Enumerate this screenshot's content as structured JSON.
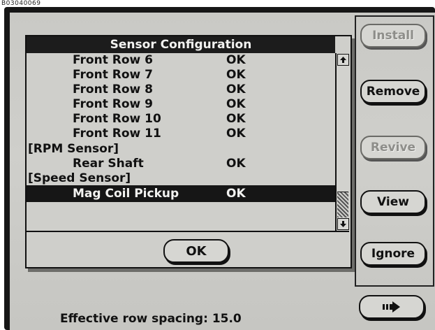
{
  "page_id": "B03040069",
  "dialog": {
    "title": "Sensor Configuration",
    "rows": [
      {
        "label": "Front Row 6",
        "status": "OK",
        "indent": true,
        "selected": false
      },
      {
        "label": "Front Row 7",
        "status": "OK",
        "indent": true,
        "selected": false
      },
      {
        "label": "Front Row 8",
        "status": "OK",
        "indent": true,
        "selected": false
      },
      {
        "label": "Front Row 9",
        "status": "OK",
        "indent": true,
        "selected": false
      },
      {
        "label": "Front Row 10",
        "status": "OK",
        "indent": true,
        "selected": false
      },
      {
        "label": "Front Row 11",
        "status": "OK",
        "indent": true,
        "selected": false
      },
      {
        "label": "[RPM Sensor]",
        "status": "",
        "indent": false,
        "selected": false
      },
      {
        "label": "Rear Shaft",
        "status": "OK",
        "indent": true,
        "selected": false
      },
      {
        "label": "[Speed Sensor]",
        "status": "",
        "indent": false,
        "selected": false
      },
      {
        "label": "Mag Coil Pickup",
        "status": "OK",
        "indent": true,
        "selected": true
      }
    ],
    "ok_label": "OK"
  },
  "side_panel": {
    "install_label": "Install",
    "remove_label": "Remove",
    "revive_label": "Revive",
    "view_label": "View",
    "ignore_label": "Ignore"
  },
  "footer": {
    "row_spacing_text": "Effective row spacing: 15.0"
  },
  "icons": {
    "scroll_up": "up-arrow-icon",
    "scroll_down": "down-arrow-icon",
    "next": "next-page-icon"
  },
  "colors": {
    "screen_bg": "#cfcfcb",
    "title_bar": "#1c1c1c",
    "disabled_text": "#8e8e8a"
  }
}
